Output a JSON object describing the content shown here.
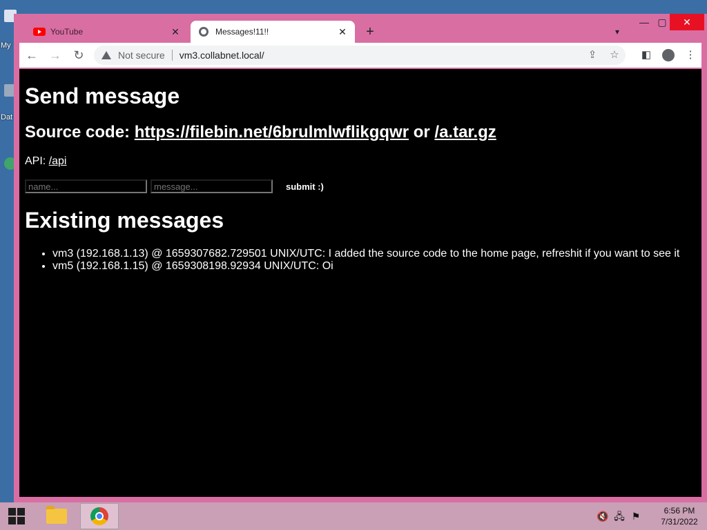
{
  "desktop": {
    "labels": [
      "My",
      "Dat"
    ]
  },
  "tabs": [
    {
      "title": "YouTube",
      "active": false
    },
    {
      "title": "Messages!11!!",
      "active": true
    }
  ],
  "address_bar": {
    "security": "Not secure",
    "url": "vm3.collabnet.local/"
  },
  "page": {
    "heading": "Send message",
    "source_prefix": "Source code:",
    "source_link": "https://filebin.net/6brulmlwflikgqwr",
    "source_or": "or",
    "tar_link": "/a.tar.gz",
    "api_prefix": "API:",
    "api_link": "/api",
    "form": {
      "name_placeholder": "name...",
      "message_placeholder": "message...",
      "submit_label": "submit :)"
    },
    "existing_heading": "Existing messages",
    "messages": [
      "vm3 (192.168.1.13) @ 1659307682.729501 UNIX/UTC: I added the source code to the home page, refreshit if you want to see it",
      "vm5 (192.168.1.15) @ 1659308198.92934 UNIX/UTC: Oi"
    ]
  },
  "taskbar": {
    "time": "6:56 PM",
    "date": "7/31/2022"
  },
  "colors": {
    "window_frame": "#d96ea3",
    "page_background": "#000000",
    "page_text": "#ffffff",
    "close_button": "#e81123"
  }
}
